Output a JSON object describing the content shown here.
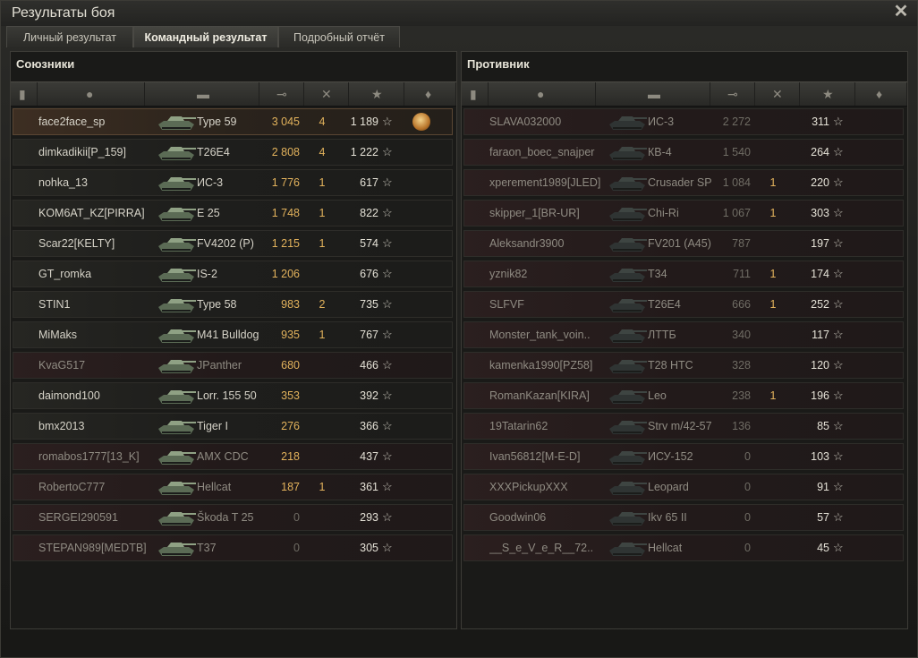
{
  "window": {
    "title": "Результаты боя",
    "close_icon": "close-icon"
  },
  "tabs": [
    {
      "label": "Личный результат",
      "active": false
    },
    {
      "label": "Командный результат",
      "active": true
    },
    {
      "label": "Подробный отчёт",
      "active": false
    }
  ],
  "allies": {
    "title": "Союзники",
    "rows": [
      {
        "player": "face2face_sp",
        "vehicle": "Type 59",
        "damage": "3 045",
        "kills": "4",
        "xp": "1 189",
        "medal": true,
        "highlight": true,
        "dead": false
      },
      {
        "player": "dimkadikii[P_159]",
        "vehicle": "T26E4",
        "damage": "2 808",
        "kills": "4",
        "xp": "1 222",
        "medal": false,
        "highlight": false,
        "dead": false
      },
      {
        "player": "nohka_13",
        "vehicle": "ИС-3",
        "damage": "1 776",
        "kills": "1",
        "xp": "617",
        "medal": false,
        "highlight": false,
        "dead": false
      },
      {
        "player": "KOM6AT_KZ[PIRRA]",
        "vehicle": "E 25",
        "damage": "1 748",
        "kills": "1",
        "xp": "822",
        "medal": false,
        "highlight": false,
        "dead": false
      },
      {
        "player": "Scar22[KELTY]",
        "vehicle": "FV4202 (P)",
        "damage": "1 215",
        "kills": "1",
        "xp": "574",
        "medal": false,
        "highlight": false,
        "dead": false
      },
      {
        "player": "GT_romka",
        "vehicle": "IS-2",
        "damage": "1 206",
        "kills": "",
        "xp": "676",
        "medal": false,
        "highlight": false,
        "dead": false
      },
      {
        "player": "STIN1",
        "vehicle": "Type 58",
        "damage": "983",
        "kills": "2",
        "xp": "735",
        "medal": false,
        "highlight": false,
        "dead": false
      },
      {
        "player": "MiMaks",
        "vehicle": "M41 Bulldog",
        "damage": "935",
        "kills": "1",
        "xp": "767",
        "medal": false,
        "highlight": false,
        "dead": false
      },
      {
        "player": "KvaG517",
        "vehicle": "JPanther",
        "damage": "680",
        "kills": "",
        "xp": "466",
        "medal": false,
        "highlight": false,
        "dead": true
      },
      {
        "player": "daimond100",
        "vehicle": "Lorr. 155 50",
        "damage": "353",
        "kills": "",
        "xp": "392",
        "medal": false,
        "highlight": false,
        "dead": false
      },
      {
        "player": "bmx2013",
        "vehicle": "Tiger I",
        "damage": "276",
        "kills": "",
        "xp": "366",
        "medal": false,
        "highlight": false,
        "dead": false
      },
      {
        "player": "romabos1777[13_K]",
        "vehicle": "AMX CDC",
        "damage": "218",
        "kills": "",
        "xp": "437",
        "medal": false,
        "highlight": false,
        "dead": true
      },
      {
        "player": "RobertoC777",
        "vehicle": "Hellcat",
        "damage": "187",
        "kills": "1",
        "xp": "361",
        "medal": false,
        "highlight": false,
        "dead": true
      },
      {
        "player": "SERGEI290591",
        "vehicle": "Škoda T 25",
        "damage": "0",
        "kills": "",
        "xp": "293",
        "medal": false,
        "highlight": false,
        "dead": true
      },
      {
        "player": "STEPAN989[MEDTB]",
        "vehicle": "T37",
        "damage": "0",
        "kills": "",
        "xp": "305",
        "medal": false,
        "highlight": false,
        "dead": true
      }
    ]
  },
  "enemies": {
    "title": "Противник",
    "rows": [
      {
        "player": "SLAVA032000",
        "vehicle": "ИС-3",
        "damage": "2 272",
        "kills": "",
        "xp": "311",
        "dead": true
      },
      {
        "player": "faraon_boec_snajper",
        "vehicle": "КВ-4",
        "damage": "1 540",
        "kills": "",
        "xp": "264",
        "dead": true
      },
      {
        "player": "xperement1989[JLED]",
        "vehicle": "Crusader SP",
        "damage": "1 084",
        "kills": "1",
        "xp": "220",
        "dead": true
      },
      {
        "player": "skipper_1[BR-UR]",
        "vehicle": "Chi-Ri",
        "damage": "1 067",
        "kills": "1",
        "xp": "303",
        "dead": true
      },
      {
        "player": "Aleksandr3900",
        "vehicle": "FV201 (A45)",
        "damage": "787",
        "kills": "",
        "xp": "197",
        "dead": true
      },
      {
        "player": "yznik82",
        "vehicle": "T34",
        "damage": "711",
        "kills": "1",
        "xp": "174",
        "dead": true
      },
      {
        "player": "SLFVF",
        "vehicle": "T26E4",
        "damage": "666",
        "kills": "1",
        "xp": "252",
        "dead": true
      },
      {
        "player": "Monster_tank_voin..",
        "vehicle": "ЛТТБ",
        "damage": "340",
        "kills": "",
        "xp": "117",
        "dead": true
      },
      {
        "player": "kamenka1990[PZ58]",
        "vehicle": "T28 HTC",
        "damage": "328",
        "kills": "",
        "xp": "120",
        "dead": true
      },
      {
        "player": "RomanKazan[KIRA]",
        "vehicle": "Leo",
        "damage": "238",
        "kills": "1",
        "xp": "196",
        "dead": true
      },
      {
        "player": "19Tatarin62",
        "vehicle": "Strv m/42-57",
        "damage": "136",
        "kills": "",
        "xp": "85",
        "dead": true
      },
      {
        "player": "Ivan56812[M-E-D]",
        "vehicle": "ИСУ-152",
        "damage": "0",
        "kills": "",
        "xp": "103",
        "dead": true
      },
      {
        "player": "XXXPickupXXX",
        "vehicle": "Leopard",
        "damage": "0",
        "kills": "",
        "xp": "91",
        "dead": true
      },
      {
        "player": "Goodwin06",
        "vehicle": "Ikv 65 II",
        "damage": "0",
        "kills": "",
        "xp": "57",
        "dead": true
      },
      {
        "player": "__S_e_V_e_R__72..",
        "vehicle": "Hellcat",
        "damage": "0",
        "kills": "",
        "xp": "45",
        "dead": true
      }
    ]
  },
  "header_icons": [
    "squad-icon",
    "player-icon",
    "tank-icon",
    "damage-icon",
    "kills-icon",
    "xp-star-icon",
    "medal-icon"
  ],
  "colors": {
    "damage": "#e2b25c",
    "kills": "#e2b25c",
    "highlight_row": "#3d2e22"
  }
}
